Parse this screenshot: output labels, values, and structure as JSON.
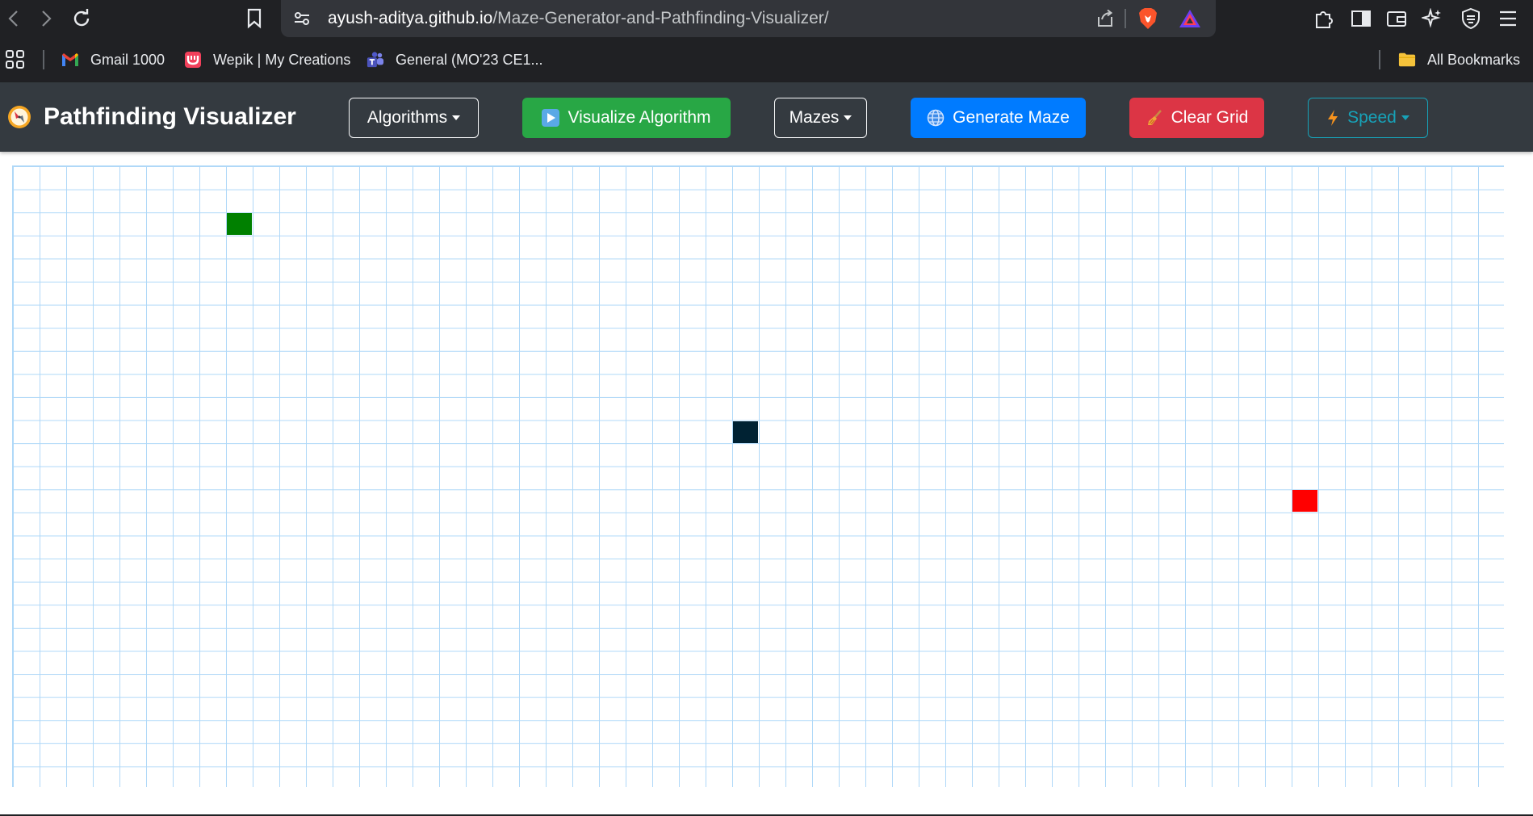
{
  "browser": {
    "url_host": "ayush-aditya.github.io",
    "url_path": "/Maze-Generator-and-Pathfinding-Visualizer/",
    "bookmarks": [
      {
        "label": "Gmail 1000",
        "icon": "gmail-icon"
      },
      {
        "label": "Wepik | My Creations",
        "icon": "wepik-icon"
      },
      {
        "label": "General (MO'23 CE1...",
        "icon": "teams-icon"
      }
    ],
    "all_bookmarks_label": "All Bookmarks"
  },
  "app": {
    "title": "Pathfinding Visualizer",
    "logo_icon": "compass-icon",
    "nav": {
      "algorithms": "Algorithms",
      "visualize": "Visualize Algorithm",
      "mazes": "Mazes",
      "generate_maze": "Generate Maze",
      "clear_grid": "Clear Grid",
      "speed": "Speed"
    }
  },
  "grid": {
    "columns": 56,
    "rows": 27,
    "start_node": {
      "row": 2,
      "col": 8,
      "color": "#008000"
    },
    "wall_node": {
      "row": 11,
      "col": 27,
      "color": "#002233"
    },
    "target_node": {
      "row": 14,
      "col": 48,
      "color": "#ff0000"
    },
    "line_color": "#afd8f8"
  },
  "colors": {
    "navbar": "#343a40",
    "success": "#28a745",
    "primary": "#007bff",
    "danger": "#dc3545",
    "info": "#17a2b8"
  }
}
